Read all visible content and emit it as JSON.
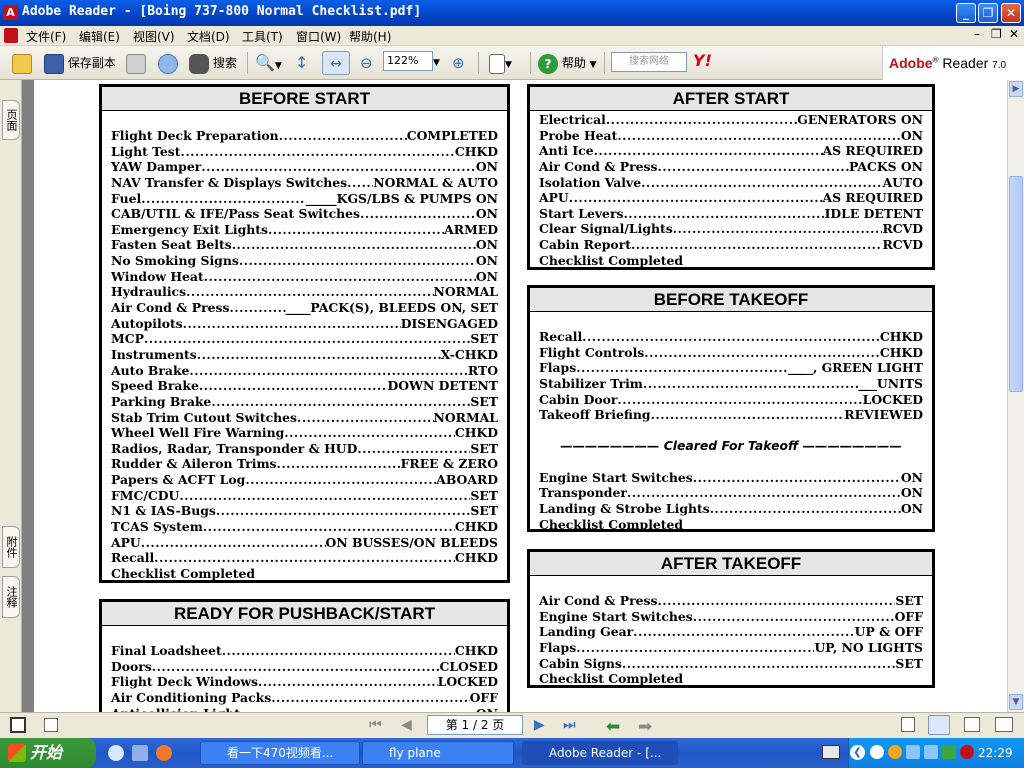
{
  "window": {
    "title": "Adobe Reader - [Boing 737-800 Normal Checklist.pdf]"
  },
  "menu": [
    "文件(F)",
    "编辑(E)",
    "视图(V)",
    "文档(D)",
    "工具(T)",
    "窗口(W)",
    "帮助(H)"
  ],
  "toolbar": {
    "save_copy": "保存副本",
    "search": "搜索",
    "zoom": "122%",
    "help": "帮助",
    "search_web_placeholder": "搜索网络",
    "brand": "Adobe",
    "brand2": "Reader",
    "version": "7.0"
  },
  "left_tabs": {
    "pages": "页面",
    "attachments": "附件",
    "comments": "注释"
  },
  "checklists": {
    "before_start": {
      "title": "BEFORE START",
      "items": [
        {
          "l": "Flight Deck Preparation",
          "v": "COMPLETED"
        },
        {
          "l": "Light Test",
          "v": "CHKD"
        },
        {
          "l": "YAW Damper",
          "v": "ON"
        },
        {
          "l": "NAV Transfer & Displays Switches",
          "v": "NORMAL & AUTO"
        },
        {
          "l": "Fuel",
          "v": "_____KGS/LBS & PUMPS ON"
        },
        {
          "l": "CAB/UTIL & IFE/Pass Seat Switches",
          "v": "ON"
        },
        {
          "l": "Emergency Exit Lights",
          "v": "ARMED"
        },
        {
          "l": "Fasten Seat Belts",
          "v": "ON"
        },
        {
          "l": "No Smoking Signs",
          "v": "ON"
        },
        {
          "l": "Window Heat",
          "v": "ON"
        },
        {
          "l": "Hydraulics",
          "v": "NORMAL"
        },
        {
          "l": "Air Cond & Press",
          "v": "____PACK(S), BLEEDS ON, SET"
        },
        {
          "l": "Autopilots",
          "v": "DISENGAGED"
        },
        {
          "l": "MCP",
          "v": "SET"
        },
        {
          "l": "Instruments",
          "v": "X-CHKD"
        },
        {
          "l": "Auto Brake",
          "v": "RTO"
        },
        {
          "l": "Speed Brake",
          "v": "DOWN DETENT"
        },
        {
          "l": "Parking Brake",
          "v": "SET"
        },
        {
          "l": "Stab Trim Cutout Switches",
          "v": "NORMAL"
        },
        {
          "l": "Wheel Well Fire Warning",
          "v": "CHKD"
        },
        {
          "l": "Radios, Radar, Transponder & HUD",
          "v": "SET"
        },
        {
          "l": "Rudder & Aileron Trims",
          "v": "FREE & ZERO"
        },
        {
          "l": "Papers & ACFT Log",
          "v": "ABOARD"
        },
        {
          "l": "FMC/CDU",
          "v": "SET"
        },
        {
          "l": "N1 & IAS-Bugs",
          "v": "SET"
        },
        {
          "l": "TCAS System",
          "v": "CHKD"
        },
        {
          "l": "APU",
          "v": "ON BUSSES/ON BLEEDS"
        },
        {
          "l": "Recall",
          "v": "CHKD"
        }
      ],
      "completed": "Checklist Completed"
    },
    "ready_pushback": {
      "title": "READY FOR PUSHBACK/START",
      "items": [
        {
          "l": "Final Loadsheet",
          "v": "CHKD"
        },
        {
          "l": "Doors",
          "v": "CLOSED"
        },
        {
          "l": "Flight Deck Windows",
          "v": "LOCKED"
        },
        {
          "l": "Air Conditioning Packs",
          "v": "OFF"
        },
        {
          "l": "Anticollision Light",
          "v": "ON"
        }
      ]
    },
    "after_start": {
      "title": "AFTER START",
      "items": [
        {
          "l": "Electrical",
          "v": "GENERATORS ON"
        },
        {
          "l": "Probe Heat",
          "v": "ON"
        },
        {
          "l": "Anti Ice",
          "v": "AS REQUIRED"
        },
        {
          "l": "Air Cond & Press",
          "v": "PACKS ON"
        },
        {
          "l": "Isolation Valve",
          "v": "AUTO"
        },
        {
          "l": "APU",
          "v": "AS REQUIRED"
        },
        {
          "l": "Start Levers",
          "v": "IDLE DETENT"
        },
        {
          "l": "Clear Signal/Lights",
          "v": "RCVD"
        },
        {
          "l": "Cabin Report",
          "v": "RCVD"
        }
      ],
      "completed": "Checklist Completed"
    },
    "before_takeoff": {
      "title": "BEFORE TAKEOFF",
      "items": [
        {
          "l": "Recall",
          "v": "CHKD"
        },
        {
          "l": "Flight Controls",
          "v": "CHKD"
        },
        {
          "l": "Flaps",
          "v": "____, GREEN LIGHT"
        },
        {
          "l": "Stabilizer Trim",
          "v": "___UNITS"
        },
        {
          "l": "Cabin Door",
          "v": "LOCKED"
        },
        {
          "l": "Takeoff Briefing",
          "v": "REVIEWED"
        }
      ],
      "cleared": "———————— Cleared For Takeoff ————————",
      "items2": [
        {
          "l": "Engine Start Switches",
          "v": "ON"
        },
        {
          "l": "Transponder",
          "v": "ON"
        },
        {
          "l": "Landing & Strobe Lights",
          "v": "ON"
        }
      ],
      "completed": "Checklist Completed"
    },
    "after_takeoff": {
      "title": "AFTER TAKEOFF",
      "items": [
        {
          "l": "Air Cond &  Press",
          "v": "SET"
        },
        {
          "l": "Engine Start Switches",
          "v": "OFF"
        },
        {
          "l": "Landing Gear",
          "v": "UP & OFF"
        },
        {
          "l": "Flaps",
          "v": "UP, NO LIGHTS"
        },
        {
          "l": "Cabin Signs",
          "v": "SET"
        }
      ],
      "completed": "Checklist Completed"
    }
  },
  "status": {
    "page": "第 1 / 2 页"
  },
  "taskbar": {
    "start": "开始",
    "tasks": [
      "看一下470视频看...",
      "fly plane",
      "Adobe Reader - [..."
    ],
    "clock": "22:29"
  }
}
